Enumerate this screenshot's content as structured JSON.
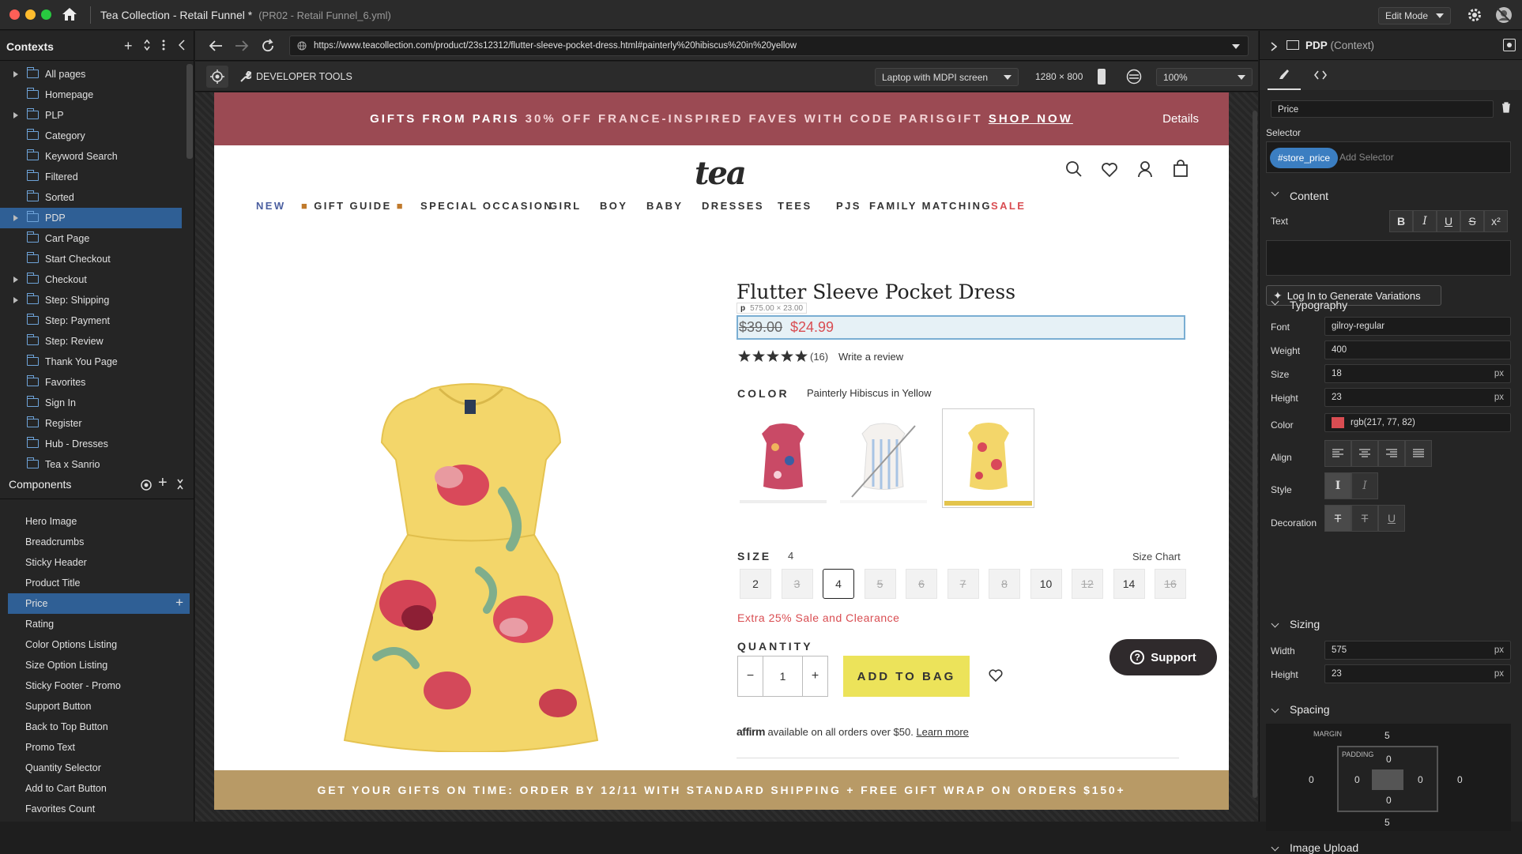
{
  "app": {
    "title": "Tea Collection - Retail Funnel *",
    "file": "(PR02 - Retail Funnel_6.yml)",
    "mode": "Edit Mode"
  },
  "contexts": {
    "header": "Contexts",
    "items": [
      {
        "label": "All pages",
        "expandable": true
      },
      {
        "label": "Homepage",
        "expandable": false
      },
      {
        "label": "PLP",
        "expandable": true
      },
      {
        "label": "Category",
        "expandable": false
      },
      {
        "label": "Keyword Search",
        "expandable": false
      },
      {
        "label": "Filtered",
        "expandable": false
      },
      {
        "label": "Sorted",
        "expandable": false
      },
      {
        "label": "PDP",
        "expandable": true,
        "active": true
      },
      {
        "label": "Cart Page",
        "expandable": false
      },
      {
        "label": "Start Checkout",
        "expandable": false
      },
      {
        "label": "Checkout",
        "expandable": true
      },
      {
        "label": "Step: Shipping",
        "expandable": true
      },
      {
        "label": "Step: Payment",
        "expandable": false
      },
      {
        "label": "Step: Review",
        "expandable": false
      },
      {
        "label": "Thank You Page",
        "expandable": false
      },
      {
        "label": "Favorites",
        "expandable": false
      },
      {
        "label": "Sign In",
        "expandable": false
      },
      {
        "label": "Register",
        "expandable": false
      },
      {
        "label": "Hub - Dresses",
        "expandable": false
      },
      {
        "label": "Tea x Sanrio",
        "expandable": false
      }
    ]
  },
  "components": {
    "header": "Components",
    "items": [
      "Hero Image",
      "Breadcrumbs",
      "Sticky Header",
      "Product Title",
      "Price",
      "Rating",
      "Color Options Listing",
      "Size Option Listing",
      "Sticky Footer - Promo",
      "Support Button",
      "Back to Top Button",
      "Promo Text",
      "Quantity Selector",
      "Add to Cart Button",
      "Favorites Count"
    ],
    "active_index": 4
  },
  "browser": {
    "url": "https://www.teacollection.com/product/23s12312/flutter-sleeve-pocket-dress.html#painterly%20hibiscus%20in%20yellow",
    "devtools_label": "DEVELOPER TOOLS",
    "device": "Laptop with MDPI screen",
    "resolution": "1280 × 800",
    "zoom": "100%"
  },
  "site": {
    "promo": {
      "part1": "GIFTS FROM PARIS ",
      "part2": "30% OFF FRANCE-INSPIRED FAVES WITH CODE PARISGIFT ",
      "link": "SHOP NOW",
      "details": "Details"
    },
    "logo": "tea",
    "nav": [
      "NEW",
      "GIFT GUIDE",
      "SPECIAL OCCASION",
      "GIRL",
      "BOY",
      "BABY",
      "DRESSES",
      "TEES",
      "PJS",
      "FAMILY MATCHING",
      "SALE"
    ],
    "product": {
      "title": "Flutter Sleeve Pocket Dress",
      "element_tag": "p",
      "element_size": "575.00 × 23.00",
      "price_original": "$39.00",
      "price_sale": "$24.99",
      "rating": 5,
      "review_count": "(16)",
      "write_review": "Write a review",
      "color_label": "COLOR",
      "color_value": "Painterly Hibiscus in Yellow",
      "size_label": "SIZE",
      "size_value": "4",
      "size_chart": "Size Chart",
      "sizes": [
        {
          "label": "2",
          "available": true
        },
        {
          "label": "3",
          "available": false
        },
        {
          "label": "4",
          "available": true,
          "selected": true
        },
        {
          "label": "5",
          "available": false
        },
        {
          "label": "6",
          "available": false
        },
        {
          "label": "7",
          "available": false
        },
        {
          "label": "8",
          "available": false
        },
        {
          "label": "10",
          "available": true
        },
        {
          "label": "12",
          "available": false
        },
        {
          "label": "14",
          "available": true
        },
        {
          "label": "16",
          "available": false
        }
      ],
      "sale_note": "Extra 25% Sale and Clearance",
      "quantity_label": "QUANTITY",
      "quantity": "1",
      "add_to_bag": "ADD TO BAG",
      "affirm_logo": "affirm",
      "affirm_text": "available on all orders over $50.",
      "learn_more": "Learn more"
    },
    "support": "Support",
    "footer_promo": "GET YOUR GIFTS ON TIME: ORDER BY 12/11 WITH STANDARD SHIPPING + FREE GIFT WRAP ON ORDERS $150+"
  },
  "inspector": {
    "context_title": "PDP",
    "context_suffix": "(Context)",
    "component_name": "Price",
    "selector_label": "Selector",
    "selector_chip": "#store_price",
    "add_selector": "Add Selector",
    "content_section": "Content",
    "text_label": "Text",
    "generate_button": "Log In to Generate Variations",
    "typography_section": "Typography",
    "font_label": "Font",
    "font": "gilroy-regular",
    "weight_label": "Weight",
    "weight": "400",
    "size_label": "Size",
    "size": "18",
    "height_label": "Height",
    "line_height": "23",
    "unit": "px",
    "color_label": "Color",
    "color": "rgb(217, 77, 82)",
    "color_hex": "#d94d52",
    "align_label": "Align",
    "style_label": "Style",
    "decoration_label": "Decoration",
    "sizing_section": "Sizing",
    "width_label": "Width",
    "width": "575",
    "sizing_height_label": "Height",
    "sizing_height": "23",
    "spacing_section": "Spacing",
    "margin_label": "MARGIN",
    "padding_label": "PADDING",
    "margin": {
      "top": "5",
      "right": "0",
      "bottom": "5",
      "left": "0"
    },
    "padding": {
      "top": "0",
      "right": "0",
      "bottom": "0",
      "left": "0"
    },
    "image_upload_section": "Image Upload"
  }
}
